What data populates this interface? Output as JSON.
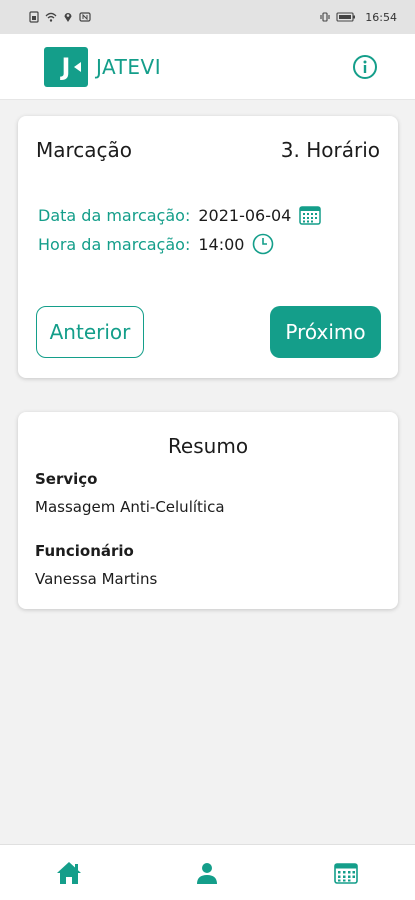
{
  "status_bar": {
    "time": "16:54",
    "left_icons": [
      "sim-icon",
      "wifi-icon",
      "location-icon",
      "nfc-icon"
    ],
    "right_icons": [
      "vibrate-icon",
      "battery-icon"
    ]
  },
  "header": {
    "logo_letter": "J",
    "app_name": "JATEVI",
    "info_icon": "info-icon"
  },
  "booking": {
    "title": "Marcação",
    "step": "3. Horário",
    "date_label": "Data da marcação:",
    "date_value": "2021-06-04",
    "time_label": "Hora da marcação:",
    "time_value": "14:00",
    "prev_label": "Anterior",
    "next_label": "Próximo"
  },
  "summary": {
    "title": "Resumo",
    "service_label": "Serviço",
    "service_value": "Massagem Anti-Celulítica",
    "employee_label": "Funcionário",
    "employee_value": "Vanessa Martins"
  },
  "bottom_nav": [
    "home-icon",
    "person-icon",
    "calendar-icon"
  ],
  "colors": {
    "accent": "#149e8a",
    "background": "#f2f2f2",
    "card": "#ffffff"
  }
}
